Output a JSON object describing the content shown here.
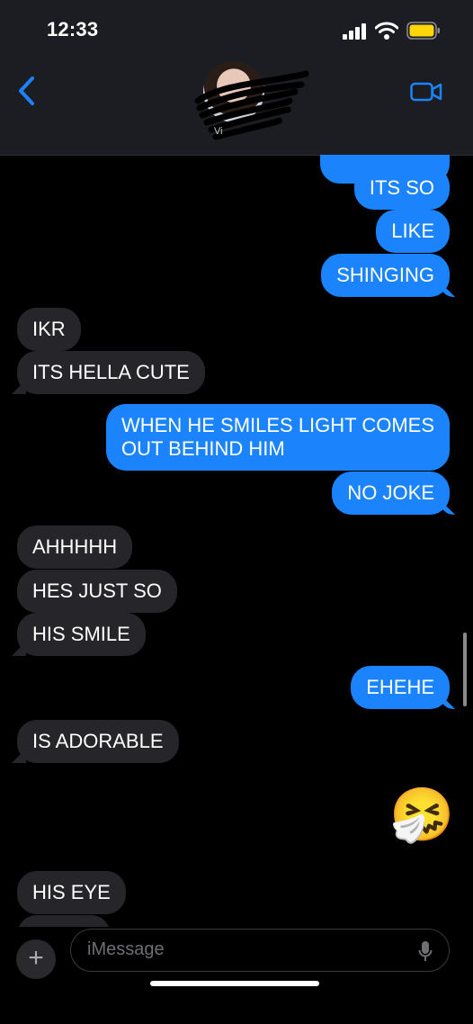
{
  "status_bar": {
    "time": "12:33"
  },
  "header": {
    "contact_name": "Vi"
  },
  "messages": [
    {
      "id": "m1",
      "direction": "out",
      "text": "ITS SO"
    },
    {
      "id": "m2",
      "direction": "out",
      "text": "LIKE"
    },
    {
      "id": "m3",
      "direction": "out",
      "text": "SHINGING"
    },
    {
      "id": "m4",
      "direction": "in",
      "text": "IKR"
    },
    {
      "id": "m5",
      "direction": "in",
      "text": "ITS HELLA CUTE"
    },
    {
      "id": "m6",
      "direction": "out",
      "line1": "WHEN HE SMILES LIGHT COMES",
      "line2": "OUT BEHIND HIM"
    },
    {
      "id": "m7",
      "direction": "out",
      "text": "NO JOKE"
    },
    {
      "id": "m8",
      "direction": "in",
      "text": "AHHHHH"
    },
    {
      "id": "m9",
      "direction": "in",
      "text": "HES JUST SO"
    },
    {
      "id": "m10",
      "direction": "in",
      "text": "HIS SMILE"
    },
    {
      "id": "m11",
      "direction": "out",
      "text": "EHEHE"
    },
    {
      "id": "m12",
      "direction": "in",
      "text": "IS ADORABLE"
    },
    {
      "id": "m13",
      "direction": "out",
      "emoji": "🤧"
    },
    {
      "id": "m14",
      "direction": "in",
      "text": "HIS EYE"
    }
  ],
  "composer": {
    "placeholder": "iMessage"
  },
  "colors": {
    "outgoing": "#1b84fd",
    "incoming": "#26262a",
    "accent": "#1b84fd"
  },
  "icons": [
    "back-chevron-icon",
    "video-call-icon",
    "plus-icon",
    "microphone-icon",
    "signal-icon",
    "wifi-icon",
    "battery-icon"
  ]
}
